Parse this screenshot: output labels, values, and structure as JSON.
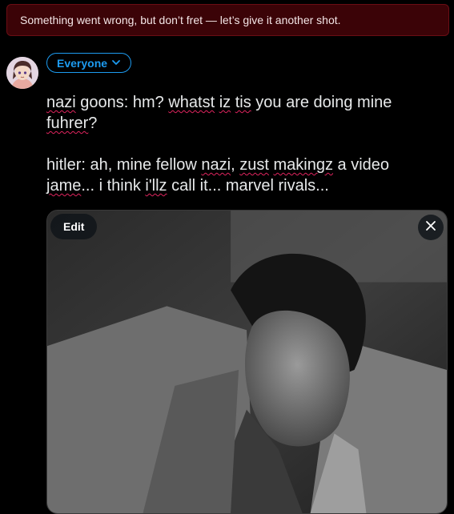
{
  "error_banner": {
    "text": "Something went wrong, but don’t fret — let’s give it another shot."
  },
  "audience": {
    "label": "Everyone",
    "icon": "chevron-down-icon"
  },
  "composer": {
    "line1_parts": [
      "",
      "nazi",
      " goons: hm? ",
      "whatst",
      " ",
      "iz",
      " ",
      "tis",
      " you are doing mine ",
      "fuhrer",
      "?"
    ],
    "line2_parts": [
      "hitler: ah, mine fellow ",
      "nazi",
      ", ",
      "zust",
      " ",
      "makingz",
      " a video ",
      "jame",
      "... i think ",
      "i'llz",
      " call it... marvel rivals..."
    ]
  },
  "media": {
    "edit_label": "Edit",
    "close_icon": "close-icon"
  },
  "colors": {
    "accent": "#1d9bf0",
    "banner_bg": "#3b0307",
    "spellcheck": "#e0245e"
  }
}
